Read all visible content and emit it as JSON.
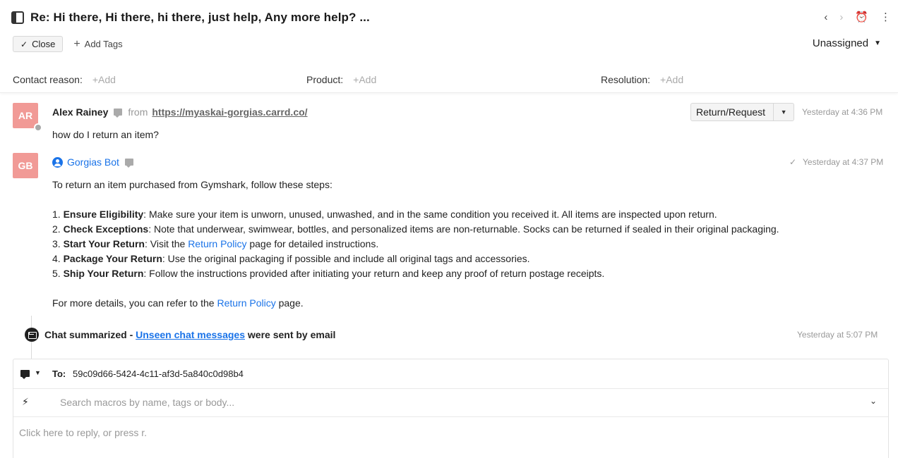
{
  "ticket": {
    "title": "Re: Hi there, Hi there, hi there, just help, Any more help? ...",
    "close_label": "Close",
    "add_tags_label": "Add Tags",
    "assignee": "Unassigned"
  },
  "fields": {
    "contact_reason_label": "Contact reason:",
    "product_label": "Product:",
    "resolution_label": "Resolution:",
    "add_label": "+Add"
  },
  "messages": [
    {
      "initials": "AR",
      "sender": "Alex Rainey",
      "from_label": "from",
      "source_url": "https://myaskai-gorgias.carrd.co/",
      "intent": "Return/Request",
      "time": "Yesterday at 4:36 PM",
      "body": "how do I return an item?"
    },
    {
      "initials": "GB",
      "sender": "Gorgias Bot",
      "time": "Yesterday at 4:37 PM",
      "intro": "To return an item purchased from Gymshark, follow these steps:",
      "steps": [
        {
          "num": "1.",
          "title": "Ensure Eligibility",
          "pre": ": Make sure your item is unworn, unused, unwashed, and in the same condition you received it. All items are inspected upon return.",
          "link": "",
          "post": ""
        },
        {
          "num": "2.",
          "title": "Check Exceptions",
          "pre": ": Note that underwear, swimwear, bottles, and personalized items are non-returnable. Socks can be returned if sealed in their original packaging.",
          "link": "",
          "post": ""
        },
        {
          "num": "3.",
          "title": "Start Your Return",
          "pre": ": Visit the ",
          "link": "Return Policy",
          "post": " page for detailed instructions."
        },
        {
          "num": "4.",
          "title": "Package Your Return",
          "pre": ": Use the original packaging if possible and include all original tags and accessories.",
          "link": "",
          "post": ""
        },
        {
          "num": "5.",
          "title": "Ship Your Return",
          "pre": ": Follow the instructions provided after initiating your return and keep any proof of return postage receipts.",
          "link": "",
          "post": ""
        }
      ],
      "outro_pre": "For more details, you can refer to the ",
      "outro_link": "Return Policy",
      "outro_post": " page."
    }
  ],
  "event": {
    "prefix": "Chat summarized - ",
    "link": "Unseen chat messages",
    "suffix": " were sent by email",
    "time": "Yesterday at 5:07 PM"
  },
  "composer": {
    "to_label": "To:",
    "to_value": "59c09d66-5424-4c11-af3d-5a840c0d98b4",
    "macro_placeholder": "Search macros by name, tags or body...",
    "reply_placeholder": "Click here to reply, or press r."
  },
  "colors": {
    "avatar_bg": "#f19a96",
    "link_blue": "#1a73e8"
  }
}
